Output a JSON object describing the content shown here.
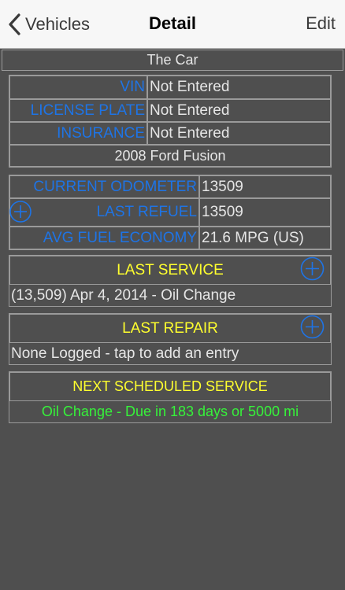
{
  "nav": {
    "back_label": "Vehicles",
    "title": "Detail",
    "edit_label": "Edit"
  },
  "vehicle_name": "The Car",
  "info": {
    "rows": [
      {
        "label": "VIN",
        "value": "Not Entered"
      },
      {
        "label": "LICENSE PLATE",
        "value": "Not Entered"
      },
      {
        "label": "INSURANCE",
        "value": "Not Entered"
      }
    ],
    "model": "2008 Ford Fusion"
  },
  "stats": {
    "rows": [
      {
        "label": "CURRENT ODOMETER",
        "value": "13509"
      },
      {
        "label": "LAST REFUEL",
        "value": "13509"
      },
      {
        "label": "AVG FUEL ECONOMY",
        "value": "21.6 MPG (US)"
      }
    ]
  },
  "last_service": {
    "header": "LAST SERVICE",
    "entry": "(13,509) Apr 4, 2014 - Oil Change"
  },
  "last_repair": {
    "header": "LAST REPAIR",
    "entry": "None Logged - tap to add an entry"
  },
  "next_service": {
    "header": "NEXT SCHEDULED SERVICE",
    "entry": "Oil Change - Due in 183 days or 5000 mi"
  },
  "colors": {
    "label_blue": "#1e74e6",
    "header_yellow": "#ffff2e",
    "due_green": "#36f23a",
    "background": "#4f4f4f"
  }
}
